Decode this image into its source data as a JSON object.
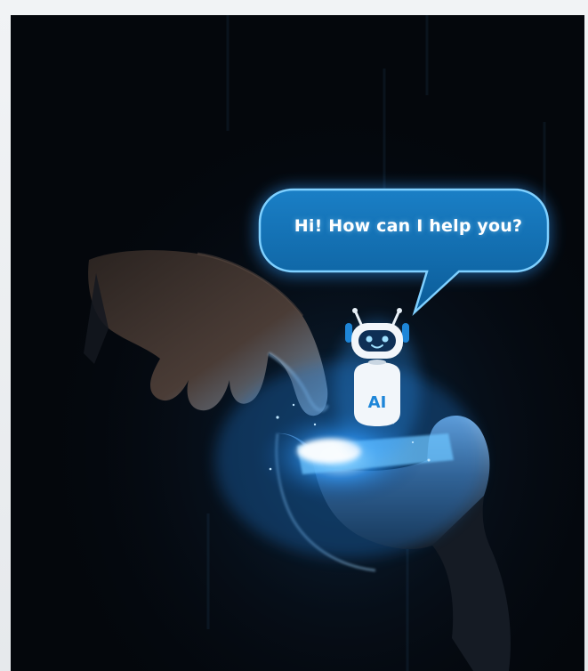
{
  "image": {
    "kind": "photo-illustration",
    "palette": {
      "background": "#04070c",
      "glow": "#2f9bff",
      "bubble": "#0d6fb0",
      "robot": "#f2f6fa"
    }
  },
  "speech_bubble": {
    "text": "Hi! How can I help you?"
  },
  "robot": {
    "label": "AI",
    "icon": "robot-icon"
  }
}
